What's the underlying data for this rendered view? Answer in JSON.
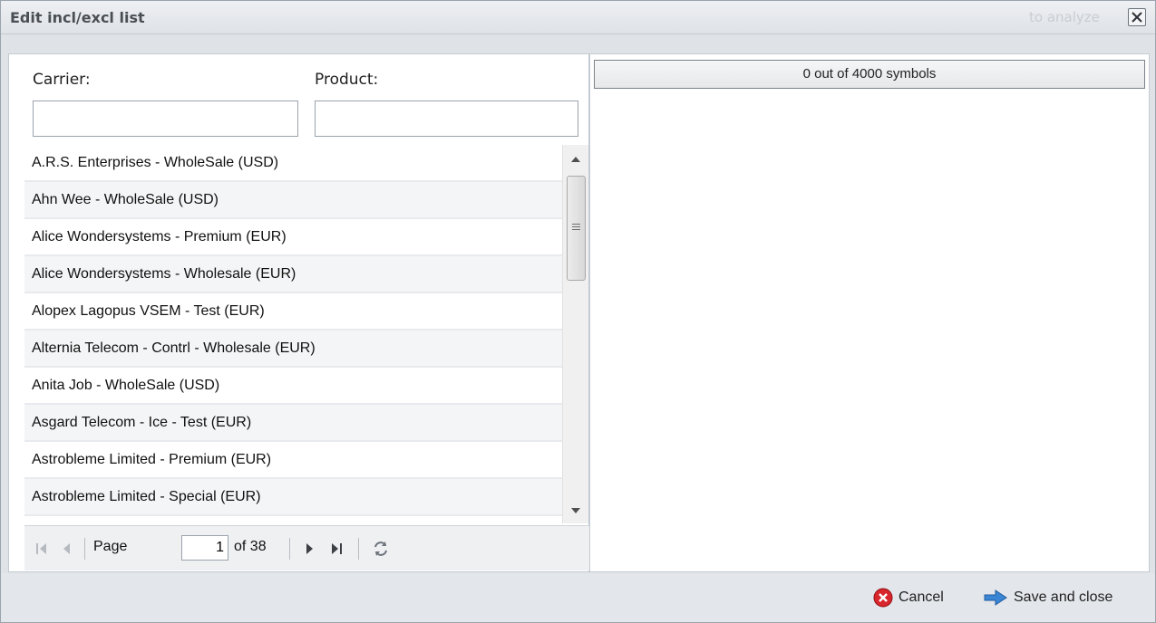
{
  "window": {
    "title": "Edit incl/excl list",
    "ghost_text": "to analyze"
  },
  "filters": {
    "carrier_label": "Carrier:",
    "carrier_value": "",
    "product_label": "Product:",
    "product_value": ""
  },
  "list": {
    "items": [
      "A.R.S. Enterprises - WholeSale (USD)",
      "Ahn Wee - WholeSale (USD)",
      "Alice Wondersystems - Premium (EUR)",
      "Alice Wondersystems - Wholesale (EUR)",
      "Alopex Lagopus VSEM - Test (EUR)",
      "Alternia Telecom - Contrl - Wholesale (EUR)",
      "Anita Job - WholeSale (USD)",
      "Asgard Telecom - Ice - Test (EUR)",
      "Astrobleme Limited - Premium (EUR)",
      "Astrobleme Limited - Special (EUR)"
    ]
  },
  "pager": {
    "page_label": "Page",
    "current_page": "1",
    "of_label": "of 38"
  },
  "symbols": {
    "counter": "0 out of 4000 symbols",
    "text": ""
  },
  "footer": {
    "cancel_label": "Cancel",
    "save_label": "Save and close"
  },
  "icons": {
    "close": "close-icon",
    "first": "first-page-icon",
    "prev": "prev-page-icon",
    "next": "next-page-icon",
    "last": "last-page-icon",
    "refresh": "refresh-icon",
    "cancel": "cancel-icon",
    "save": "save-arrow-icon"
  },
  "colors": {
    "cancel_red": "#d8262c",
    "save_blue": "#3a86d4",
    "accent_gray": "#dfe3e8"
  }
}
